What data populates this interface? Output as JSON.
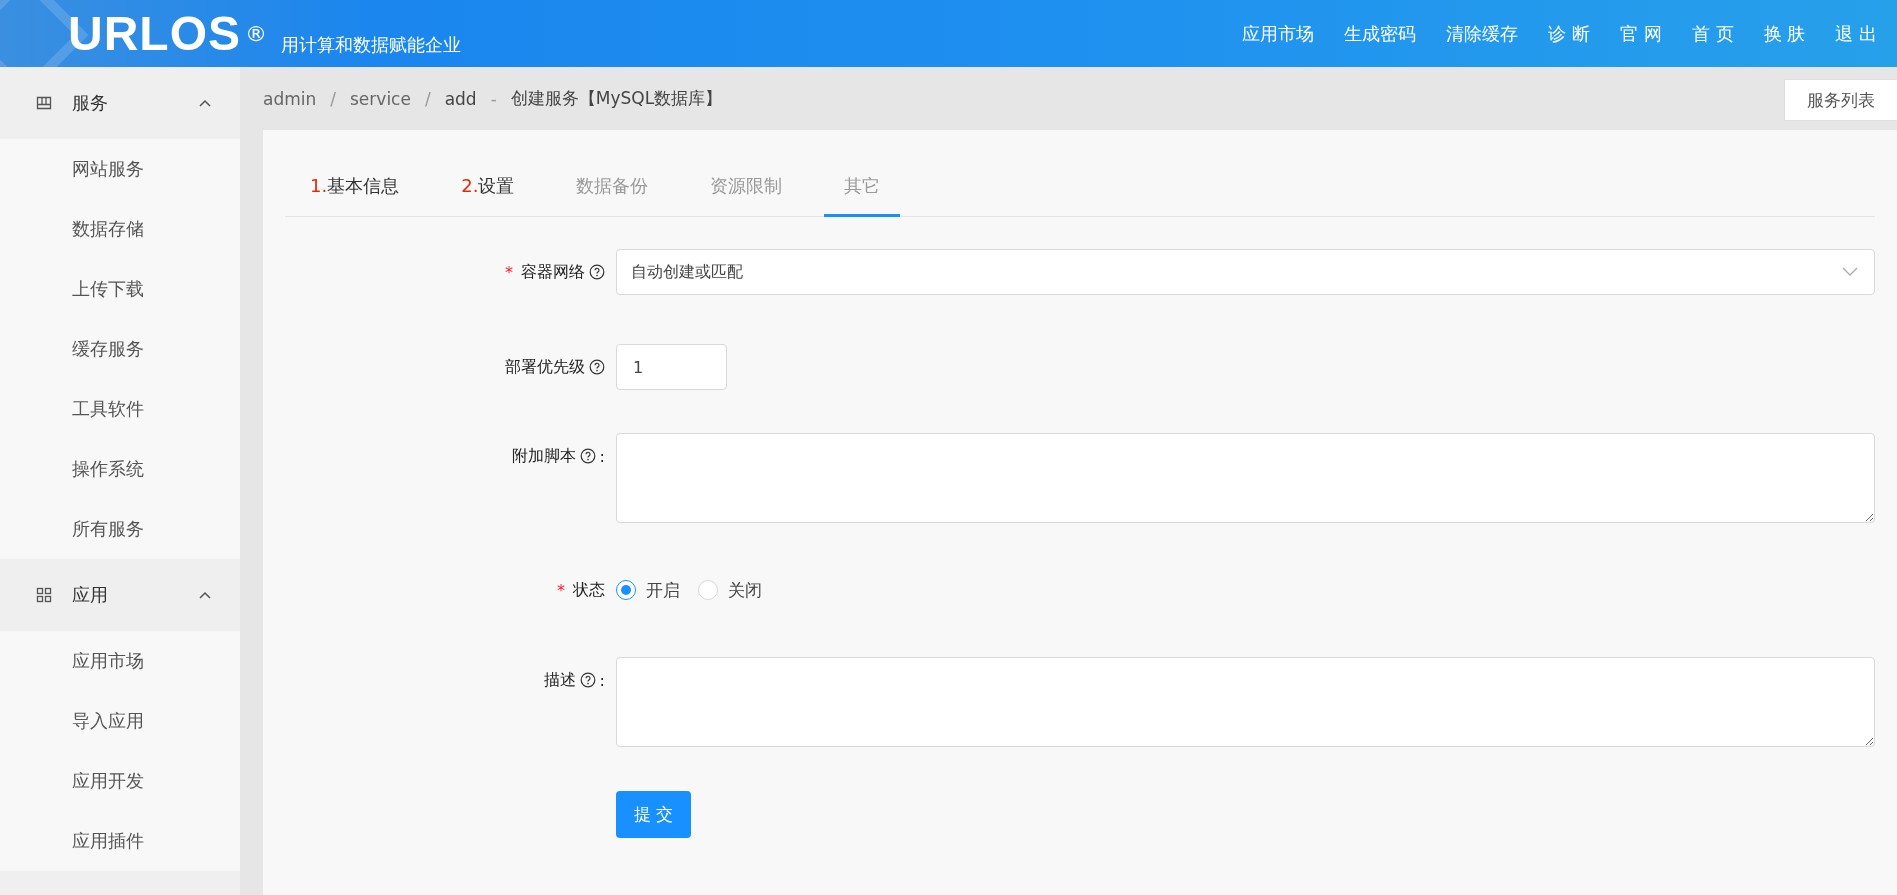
{
  "header": {
    "logo": "URLOS",
    "logo_mark": "®",
    "tagline": "用计算和数据赋能企业",
    "nav": [
      "应用市场",
      "生成密码",
      "清除缓存",
      "诊 断",
      "官 网",
      "首 页",
      "换 肤",
      "退 出"
    ]
  },
  "sidebar": {
    "groups": [
      {
        "title": "服务",
        "expanded": true,
        "items": [
          "网站服务",
          "数据存储",
          "上传下载",
          "缓存服务",
          "工具软件",
          "操作系统",
          "所有服务"
        ]
      },
      {
        "title": "应用",
        "expanded": true,
        "items": [
          "应用市场",
          "导入应用",
          "应用开发",
          "应用插件"
        ]
      }
    ]
  },
  "breadcrumb": {
    "items": [
      "admin",
      "service",
      "add"
    ],
    "separators": [
      "/",
      "/",
      "-"
    ],
    "page_title": "创建服务【MySQL数据库】",
    "button": "服务列表"
  },
  "tabs": [
    {
      "number": "1.",
      "label": "基本信息",
      "done": true,
      "selected": false
    },
    {
      "number": "2.",
      "label": "设置",
      "done": true,
      "selected": false
    },
    {
      "label": "数据备份",
      "done": false,
      "selected": false
    },
    {
      "label": "资源限制",
      "done": false,
      "selected": false
    },
    {
      "label": "其它",
      "done": false,
      "selected": true
    }
  ],
  "form": {
    "fields": [
      {
        "kind": "select",
        "mark": "*",
        "label": "容器网络",
        "help": true,
        "value": "自动创建或匹配"
      },
      {
        "kind": "input",
        "label": "部署优先级",
        "help": true,
        "value": "1"
      },
      {
        "kind": "textarea",
        "label": "附加脚本",
        "help": true,
        "suffix": ":"
      },
      {
        "kind": "radio",
        "mark": "*",
        "label": "状态",
        "help": false,
        "options": [
          {
            "label": "开启",
            "selected": true
          },
          {
            "label": "关闭",
            "selected": false
          }
        ]
      },
      {
        "kind": "textarea",
        "label": "描述",
        "help": true,
        "suffix": ":"
      }
    ],
    "submit": "提 交"
  }
}
